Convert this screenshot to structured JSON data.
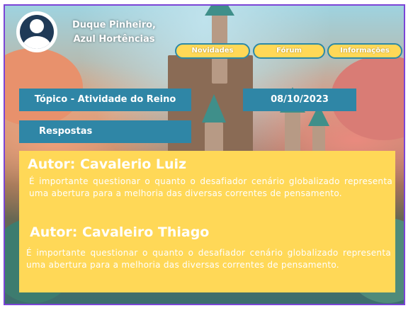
{
  "user": {
    "name_line1": "Duque Pinheiro,",
    "name_line2": "Azul Hortências"
  },
  "nav": {
    "items": [
      {
        "label": "Novidades"
      },
      {
        "label": "Fórum"
      },
      {
        "label": "Informações"
      }
    ]
  },
  "topic": {
    "title": "Tópico - Atividade do Reino",
    "date": "08/10/2023"
  },
  "section": {
    "replies_label": "Respostas"
  },
  "replies": [
    {
      "author": "Autor: Cavalerio Luiz",
      "text": "É importante questionar o quanto o desafiador cenário globalizado representa uma abertura para a melhoria das diversas correntes de pensamento."
    },
    {
      "author": "Autor: Cavaleiro Thiago",
      "text": "É importante questionar o quanto o desafiador cenário globalizado representa uma abertura para a melhoria das diversas correntes de pensamento."
    }
  ],
  "colors": {
    "accent_yellow": "#ffd857",
    "band_blue": "#2f86a6",
    "frame_purple": "#7b45d6"
  }
}
